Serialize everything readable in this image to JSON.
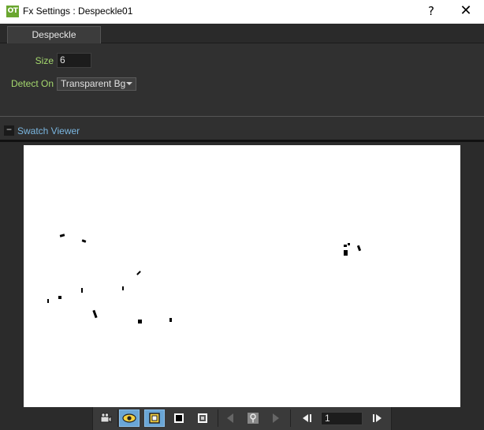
{
  "window": {
    "title": "Fx Settings : Despeckle01",
    "app_icon_text": "OT",
    "help_label": "?",
    "close_label": "✕"
  },
  "tabs": [
    {
      "label": "Despeckle",
      "active": true
    }
  ],
  "params": {
    "size": {
      "label": "Size",
      "value": "6"
    },
    "detect_on": {
      "label": "Detect On",
      "value": "Transparent Bg"
    }
  },
  "swatch": {
    "collapse_label": "−",
    "title": "Swatch Viewer"
  },
  "toolbar": {
    "frame_value": "1",
    "buttons": [
      {
        "name": "camera-view-icon",
        "active": false
      },
      {
        "name": "preview-eye-icon",
        "active": true
      },
      {
        "name": "white-bg-icon",
        "active": true
      },
      {
        "name": "black-bg-icon",
        "active": false
      },
      {
        "name": "checkerboard-bg-icon",
        "active": false
      },
      {
        "name": "prev-key-icon",
        "active": false
      },
      {
        "name": "key-icon",
        "active": false
      },
      {
        "name": "next-key-icon",
        "active": false
      },
      {
        "name": "prev-frame-icon",
        "active": false
      },
      {
        "name": "next-frame-icon",
        "active": false
      }
    ]
  },
  "colors": {
    "panel_bg": "#303030",
    "param_label": "#a5d86e",
    "link_blue": "#7ab6e0",
    "active_button": "#6aa6d6",
    "app_icon": "#6aa62f"
  }
}
